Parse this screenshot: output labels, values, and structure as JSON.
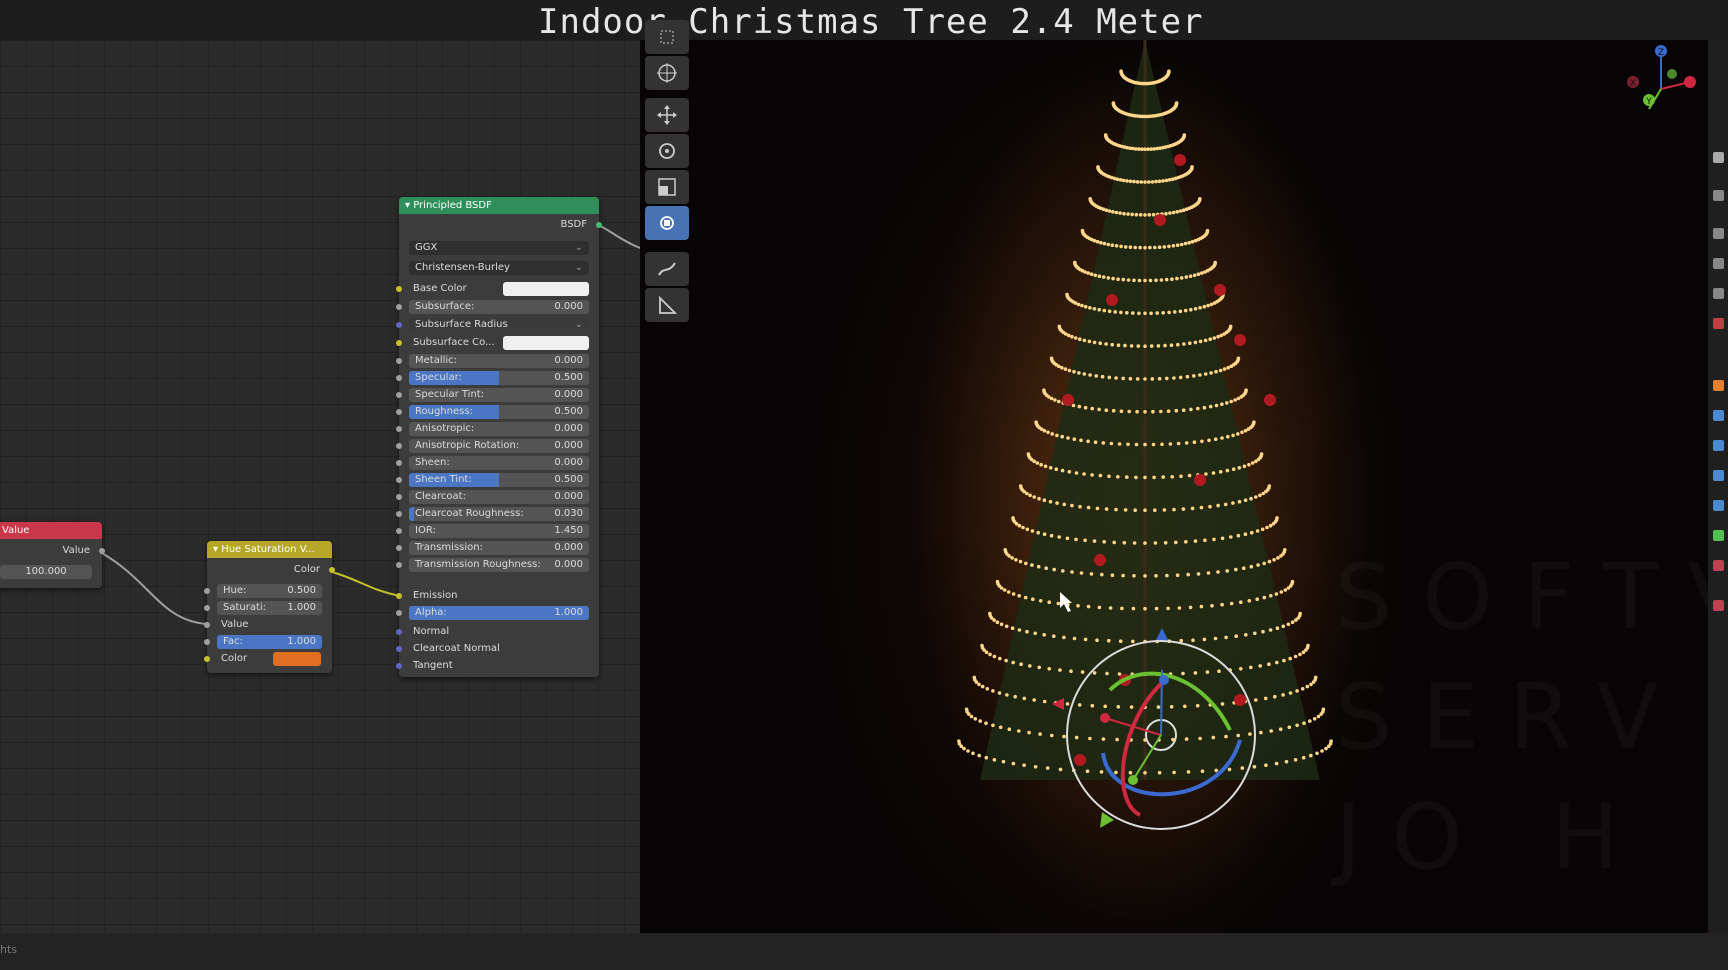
{
  "title": "Indoor Christmas Tree 2.4 Meter",
  "status_text": "hts",
  "nodes": {
    "value": {
      "header": "Value",
      "output": "Value",
      "field_value": "100.000",
      "color": "#c8384a"
    },
    "hue_sat": {
      "header": "Hue Saturation V...",
      "output": "Color",
      "color": "#b7a728",
      "rows": {
        "hue_label": "Hue:",
        "hue_value": "0.500",
        "sat_label": "Saturati:",
        "sat_value": "1.000",
        "value_label": "Value",
        "fac_label": "Fac:",
        "fac_value": "1.000",
        "fac_fraction": 1.0,
        "color_label": "Color"
      },
      "color_swatch": "#e07020"
    },
    "bsdf": {
      "header": "Principled BSDF",
      "output": "BSDF",
      "color": "#2f8f5a",
      "distribution": "GGX",
      "subsurface_method": "Christensen-Burley",
      "fields": [
        {
          "label": "Subsurface:",
          "value": "0.000",
          "fraction": 0
        },
        {
          "label": "Metallic:",
          "value": "0.000",
          "fraction": 0
        },
        {
          "label": "Specular:",
          "value": "0.500",
          "fraction": 0.5
        },
        {
          "label": "Specular Tint:",
          "value": "0.000",
          "fraction": 0
        },
        {
          "label": "Roughness:",
          "value": "0.500",
          "fraction": 0.5
        },
        {
          "label": "Anisotropic:",
          "value": "0.000",
          "fraction": 0
        },
        {
          "label": "Anisotropic Rotation:",
          "value": "0.000",
          "fraction": 0
        },
        {
          "label": "Sheen:",
          "value": "0.000",
          "fraction": 0
        },
        {
          "label": "Sheen Tint:",
          "value": "0.500",
          "fraction": 0.5
        },
        {
          "label": "Clearcoat:",
          "value": "0.000",
          "fraction": 0
        },
        {
          "label": "Clearcoat Roughness:",
          "value": "0.030",
          "fraction": 0.03
        },
        {
          "label": "IOR:",
          "value": "1.450",
          "fraction": 0
        },
        {
          "label": "Transmission:",
          "value": "0.000",
          "fraction": 0
        },
        {
          "label": "Transmission Roughness:",
          "value": "0.000",
          "fraction": 0
        },
        {
          "label": "Alpha:",
          "value": "1.000",
          "fraction": 1.0
        }
      ],
      "labels": {
        "base_color": "Base Color",
        "subsurface_radius": "Subsurface Radius",
        "subsurface_color": "Subsurface Co...",
        "emission": "Emission",
        "normal": "Normal",
        "clearcoat_normal": "Clearcoat Normal",
        "tangent": "Tangent"
      }
    }
  },
  "toolbar": [
    "select-box-icon",
    "cursor-icon",
    "move-icon",
    "rotate-icon",
    "scale-icon",
    "transform-icon",
    "annotate-icon",
    "measure-icon"
  ],
  "watermark": [
    "SOFTV",
    "SERV",
    "JO  H"
  ],
  "gizmo_axes": {
    "x": "X",
    "y": "Y",
    "z": "Z"
  }
}
